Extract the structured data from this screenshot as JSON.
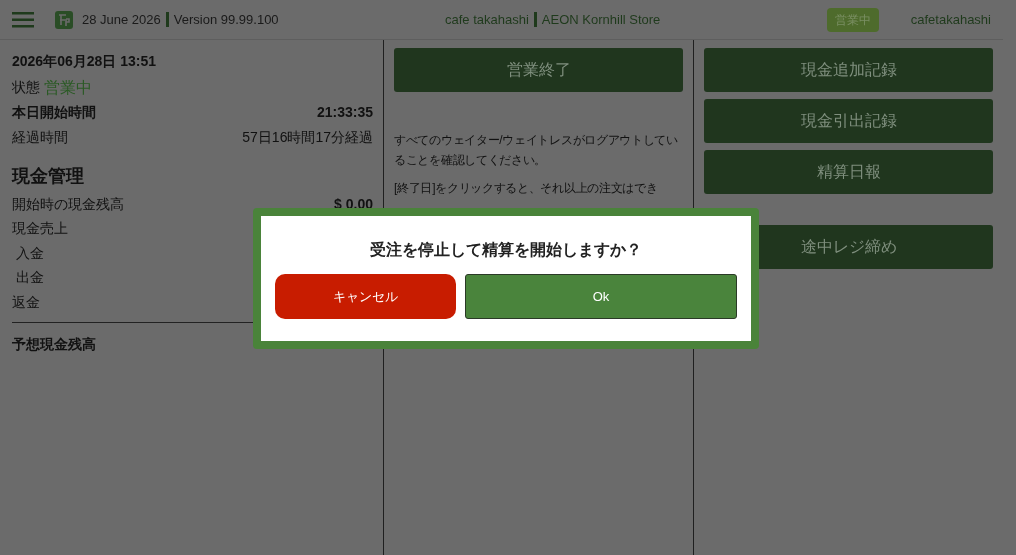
{
  "header": {
    "date": "28 June 2026",
    "version": "Version 99.99.100",
    "store_name": "cafe takahashi",
    "store_branch": "AEON Kornhill Store",
    "status_badge": "営業中",
    "user": "cafetakahashi"
  },
  "left": {
    "datetime": "2026年06月28日 13:51",
    "status_label": "状態",
    "status_value": "営業中",
    "rows": [
      {
        "label": "本日開始時間",
        "value": "21:33:35",
        "bold": true
      },
      {
        "label": "経過時間",
        "value": "57日16時間17分経過",
        "bold": false
      }
    ],
    "section_title": "現金管理",
    "cash_rows": [
      {
        "label": "開始時の現金残高",
        "value": "$ 0.00"
      },
      {
        "label": "現金売上"
      },
      {
        "label": " 入金"
      },
      {
        "label": " 出金"
      },
      {
        "label": "返金"
      }
    ],
    "expected_label": "予想現金残高"
  },
  "middle": {
    "end_button": "営業終了",
    "messages": [
      "すべてのウェイター/ウェイトレスがログアウトしていることを確認してください。",
      "[終了日]をクリックすると、それ以上の注文はでき"
    ]
  },
  "right": {
    "button_groups": [
      [
        "現金追加記録",
        "現金引出記録",
        "精算日報"
      ],
      [
        "途中レジ締め"
      ]
    ]
  },
  "dialog": {
    "message": "受注を停止して精算を開始しますか？",
    "buttons": [
      {
        "label": "キャンセル",
        "kind": "cancel"
      },
      {
        "label": "Ok",
        "kind": "confirm"
      }
    ]
  }
}
